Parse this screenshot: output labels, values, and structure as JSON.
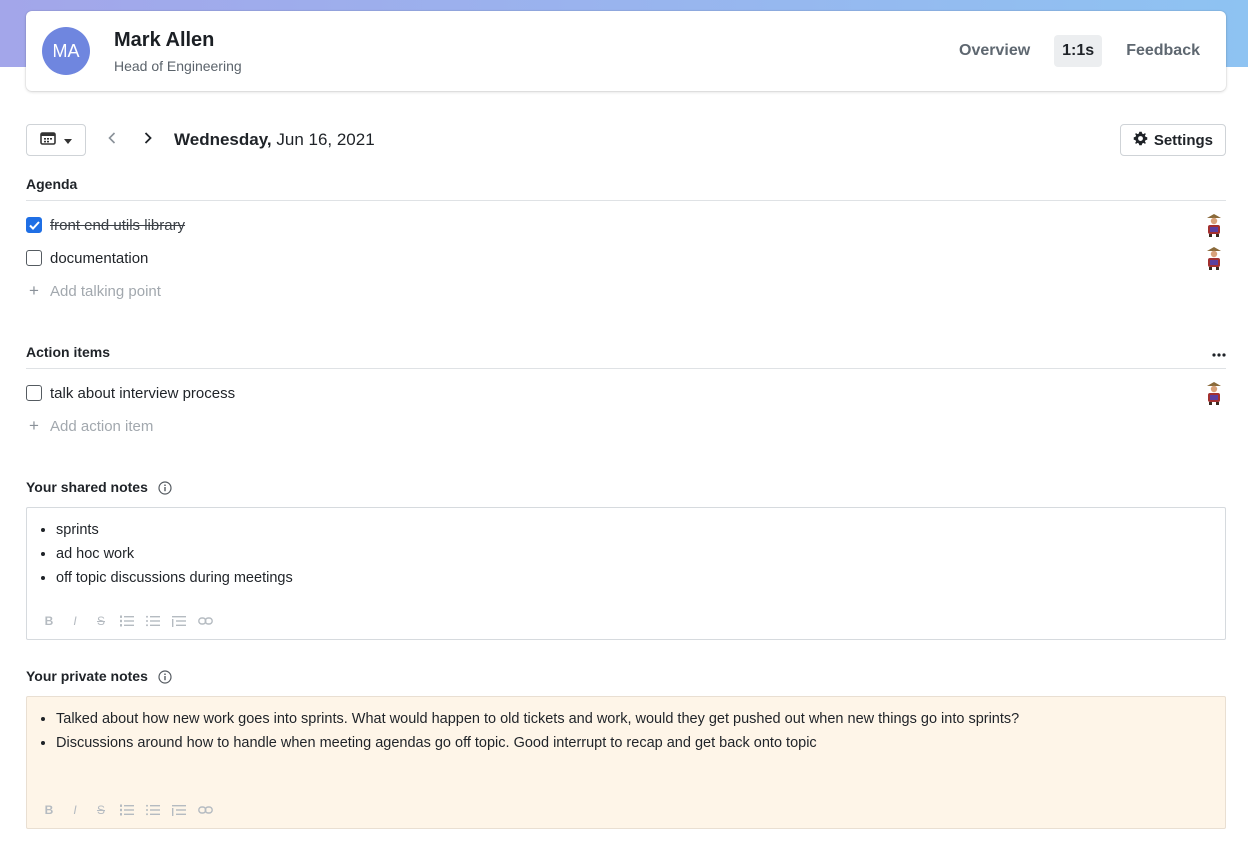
{
  "profile": {
    "initials": "MA",
    "name": "Mark Allen",
    "role": "Head of Engineering",
    "avatar_color": "#6f86df"
  },
  "nav": {
    "tabs": [
      {
        "label": "Overview",
        "active": false
      },
      {
        "label": "1:1s",
        "active": true
      },
      {
        "label": "Feedback",
        "active": false
      }
    ]
  },
  "date_bar": {
    "weekday": "Wednesday,",
    "date": " Jun 16, 2021",
    "settings_label": "Settings"
  },
  "agenda": {
    "title": "Agenda",
    "items": [
      {
        "text": "front end utils library",
        "checked": true
      },
      {
        "text": "documentation",
        "checked": false
      }
    ],
    "add_label": "Add talking point"
  },
  "action_items": {
    "title": "Action items",
    "items": [
      {
        "text": "talk about interview process",
        "checked": false
      }
    ],
    "add_label": "Add action item"
  },
  "shared_notes": {
    "title": "Your shared notes",
    "bullets": [
      "sprints",
      "ad hoc work",
      "off topic discussions during meetings"
    ]
  },
  "private_notes": {
    "title": "Your private notes",
    "bullets": [
      "Talked about how new work goes into sprints. What would happen to old tickets and work, would they get pushed out when new things go into sprints?",
      "Discussions around how to handle when meeting agendas go off topic. Good interrupt to recap and get back onto topic"
    ],
    "background": "#fef5e8"
  },
  "toolbar": {
    "bold": "B",
    "italic": "I",
    "strike": "S"
  },
  "colors": {
    "accent": "#1f6fe5",
    "gradient_start": "#a3a6ea",
    "gradient_end": "#8ec3f2"
  }
}
